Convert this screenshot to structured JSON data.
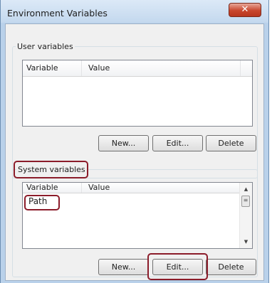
{
  "window": {
    "title": "Environment Variables",
    "close_glyph": "✕"
  },
  "user_variables": {
    "group_label": "User variables",
    "columns": [
      "Variable",
      "Value"
    ],
    "buttons": {
      "new": "New...",
      "edit": "Edit...",
      "delete": "Delete"
    }
  },
  "system_variables": {
    "group_label": "System variables",
    "columns": [
      "Variable",
      "Value"
    ],
    "rows": [
      {
        "variable": "Path",
        "value": ""
      }
    ],
    "buttons": {
      "new": "New...",
      "edit": "Edit...",
      "delete": "Delete"
    }
  },
  "colors": {
    "highlight": "#8b1c2a",
    "titlebar": "#c3d8ee",
    "close": "#c8462d"
  }
}
